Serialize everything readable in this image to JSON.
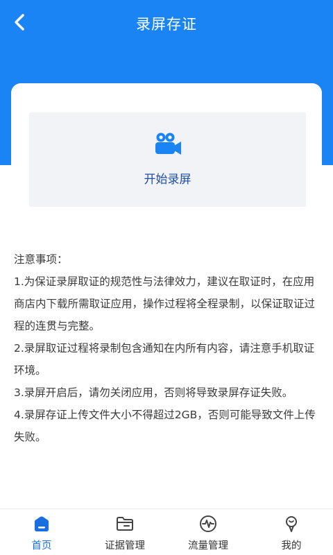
{
  "header": {
    "title": "录屏存证",
    "back_icon": "chevron-left-icon"
  },
  "record": {
    "icon": "video-camera-icon",
    "label": "开始录屏"
  },
  "notes": {
    "heading": "注意事项：",
    "items": [
      "1.为保证录屏取证的规范性与法律效力，建议在取证时，在应用商店内下载所需取证应用，操作过程将全程录制，以保证取证过程的连贯与完整。",
      "2.录屏取证过程将录制包含通知在内所有内容，请注意手机取证环境。",
      "3.录屏开启后，请勿关闭应用，否则将导致录屏存证失败。",
      "4.录屏存证上传文件大小不得超过2GB，否则可能导致文件上传失败。"
    ]
  },
  "tabbar": {
    "tabs": [
      {
        "label": "首页",
        "icon": "home-icon",
        "active": true
      },
      {
        "label": "证据管理",
        "icon": "folder-icon",
        "active": false
      },
      {
        "label": "流量管理",
        "icon": "pulse-icon",
        "active": false
      },
      {
        "label": "我的",
        "icon": "user-icon",
        "active": false
      }
    ]
  },
  "colors": {
    "primary": "#1a84f5",
    "tab_active": "#1a6fe0",
    "record_label": "#1f4fa0",
    "panel_bg": "#f2f3f7"
  }
}
